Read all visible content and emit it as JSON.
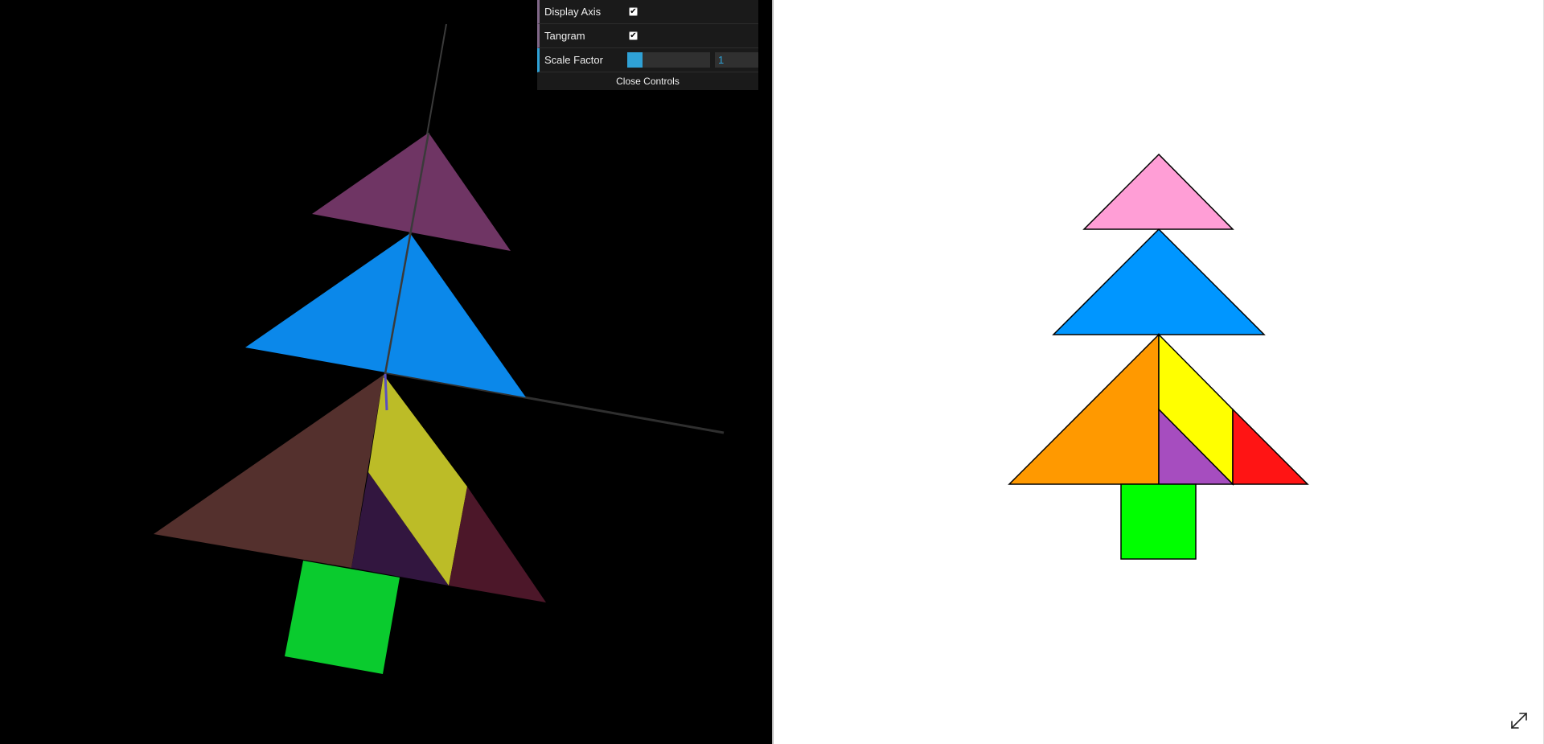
{
  "controls": {
    "display_axis_label": "Display Axis",
    "display_axis_checked": true,
    "tangram_label": "Tangram",
    "tangram_checked": true,
    "scale_factor_label": "Scale Factor",
    "scale_factor_value": "1",
    "close_label": "Close Controls"
  },
  "icons": {
    "fullscreen": "expand-arrows-icon",
    "checkbox": "checkmark-icon"
  },
  "colors": {
    "viewport_bg": "#000000",
    "canvas_bg": "#ffffff",
    "accent": "#2fa1d6"
  },
  "tangram_pieces": [
    {
      "name": "small-triangle-top",
      "color": "#ff9ed6"
    },
    {
      "name": "large-triangle-blue",
      "color": "#0096ff"
    },
    {
      "name": "large-triangle-orange",
      "color": "#ff9900"
    },
    {
      "name": "parallelogram-yellow",
      "color": "#ffff00"
    },
    {
      "name": "small-triangle-purple",
      "color": "#a64dbf"
    },
    {
      "name": "medium-triangle-red",
      "color": "#ff1414"
    },
    {
      "name": "square-green",
      "color": "#00ff00"
    }
  ]
}
